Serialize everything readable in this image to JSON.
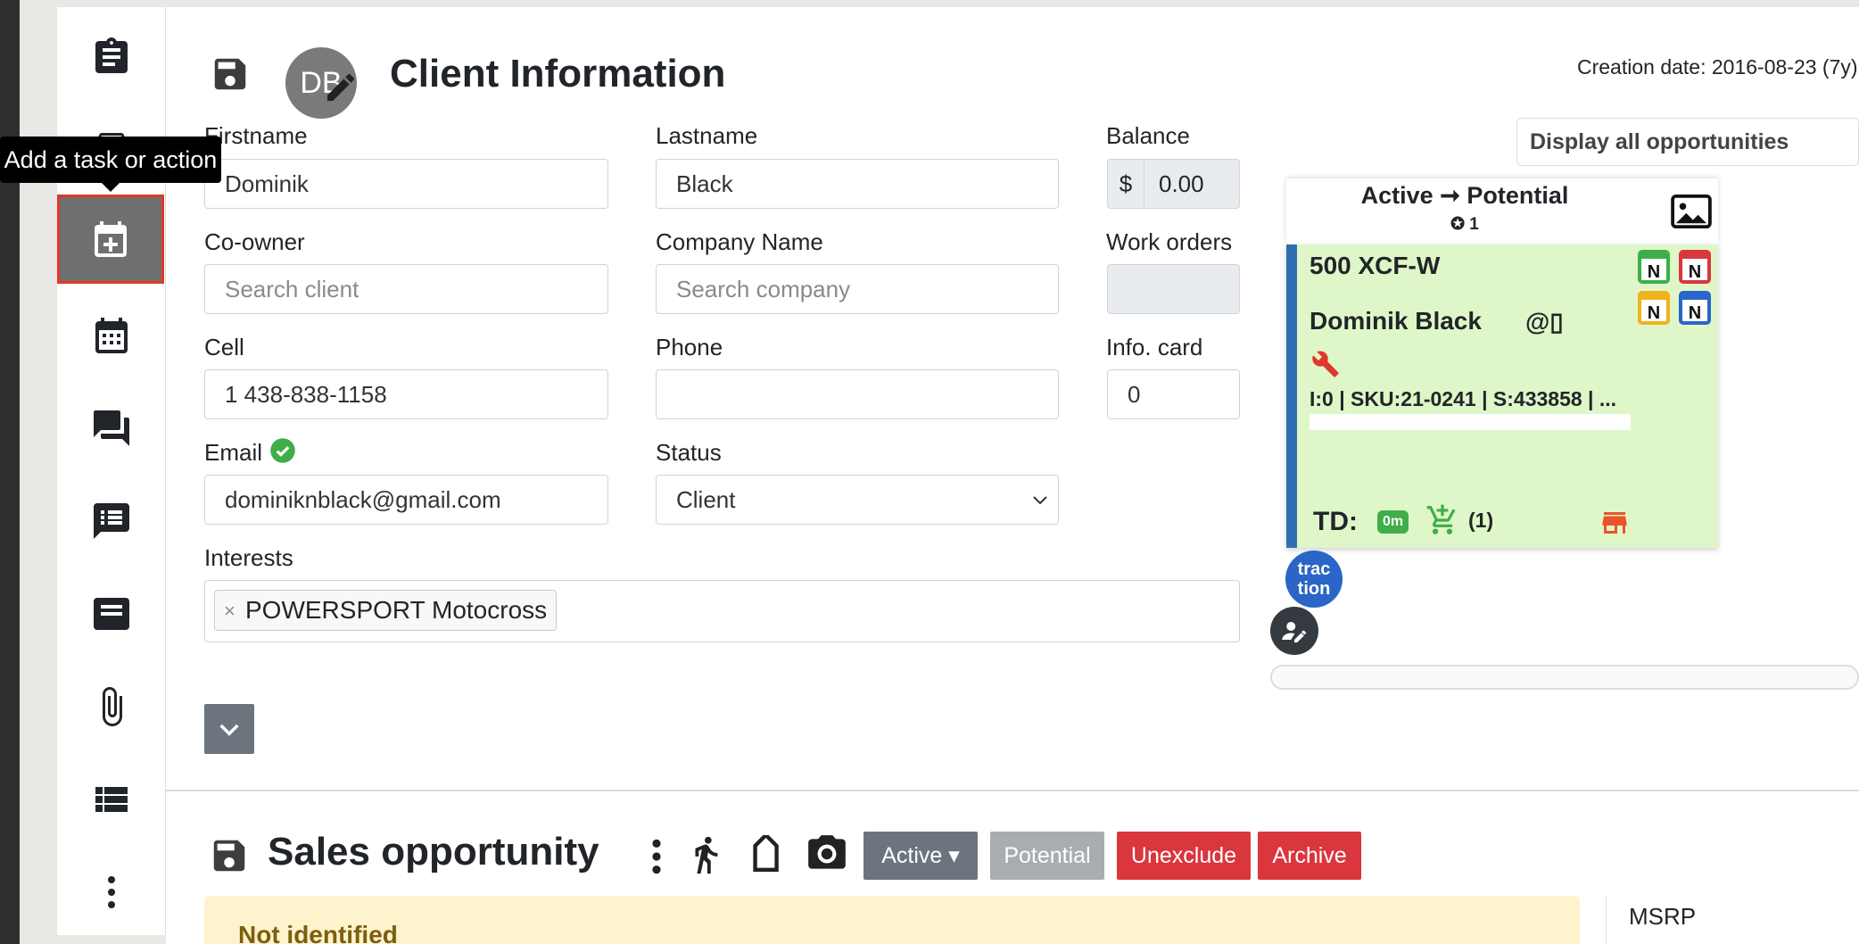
{
  "sidebar": {
    "tooltip": "Add a task or action",
    "items": [
      {
        "name": "clipboard"
      },
      {
        "name": "vehicle"
      },
      {
        "name": "add-task",
        "active": true
      },
      {
        "name": "calendar"
      },
      {
        "name": "messages"
      },
      {
        "name": "notes-list"
      },
      {
        "name": "message"
      },
      {
        "name": "attachment"
      },
      {
        "name": "list"
      },
      {
        "name": "more"
      }
    ]
  },
  "header": {
    "avatar_initials": "DB",
    "title": "Client Information",
    "creation_date": "Creation date: 2016-08-23 (7y)"
  },
  "form": {
    "firstname_label": "Firstname",
    "firstname_value": "Dominik",
    "lastname_label": "Lastname",
    "lastname_value": "Black",
    "balance_label": "Balance",
    "balance_prefix": "$",
    "balance_value": "0.00",
    "coowner_label": "Co-owner",
    "coowner_placeholder": "Search client",
    "company_label": "Company Name",
    "company_placeholder": "Search company",
    "workorders_label": "Work orders",
    "cell_label": "Cell",
    "cell_value": "1 438-838-1158",
    "phone_label": "Phone",
    "phone_value": "",
    "infocard_label": "Info. card",
    "infocard_value": "0",
    "email_label": "Email",
    "email_value": "dominiknblack@gmail.com",
    "status_label": "Status",
    "status_value": "Client",
    "interests_label": "Interests",
    "interest_tag": "POWERSPORT Motocross",
    "tag_remove": "×"
  },
  "opportunities": {
    "filter": "Display all opportunities",
    "card": {
      "title": "Active ➞ Potential",
      "subtitle": "✪ 1",
      "model": "500 XCF-W",
      "client_name": "Dominik Black",
      "contact_icons": "@▯",
      "details": "I:0 | SKU:21-0241 | S:433858 | ...",
      "td_label": "TD:",
      "time_badge": "0m",
      "cart_count": "(1)",
      "badge_letter": "N",
      "badge_colors": [
        "#3fae49",
        "#d9363e",
        "#f2b21c",
        "#2a65c7"
      ],
      "accent_color": "#2f6fb0",
      "background_color": "#dff7c8"
    },
    "brand_logo_text": "trac tion"
  },
  "sales": {
    "title": "Sales opportunity",
    "btn_active": "Active ▾",
    "btn_potential": "Potential",
    "btn_unexclude": "Unexclude",
    "btn_archive": "Archive",
    "alert_text": "Not identified",
    "msrp_label": "MSRP"
  }
}
